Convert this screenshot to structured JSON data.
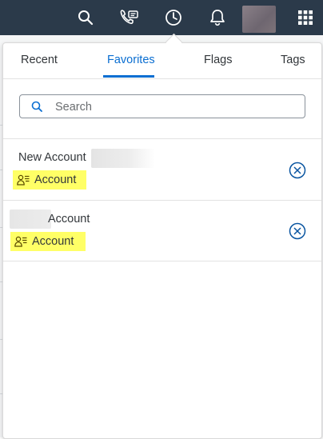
{
  "topbar": {
    "icons": [
      "search-icon",
      "phone-chat-icon",
      "clock-icon",
      "bell-icon",
      "grid-icon"
    ],
    "background": "#2b3a4a"
  },
  "popover": {
    "tabs": [
      {
        "label": "Recent"
      },
      {
        "label": "Favorites",
        "active": true
      },
      {
        "label": "Flags"
      },
      {
        "label": "Tags"
      }
    ],
    "search": {
      "placeholder": "Search",
      "value": ""
    },
    "items": [
      {
        "title": "New Account",
        "badge": "Account"
      },
      {
        "title": "Account",
        "badge": "Account"
      }
    ]
  },
  "colors": {
    "accent": "#0a6ed1",
    "badge_highlight": "#ffff66",
    "text": "#32363a"
  }
}
